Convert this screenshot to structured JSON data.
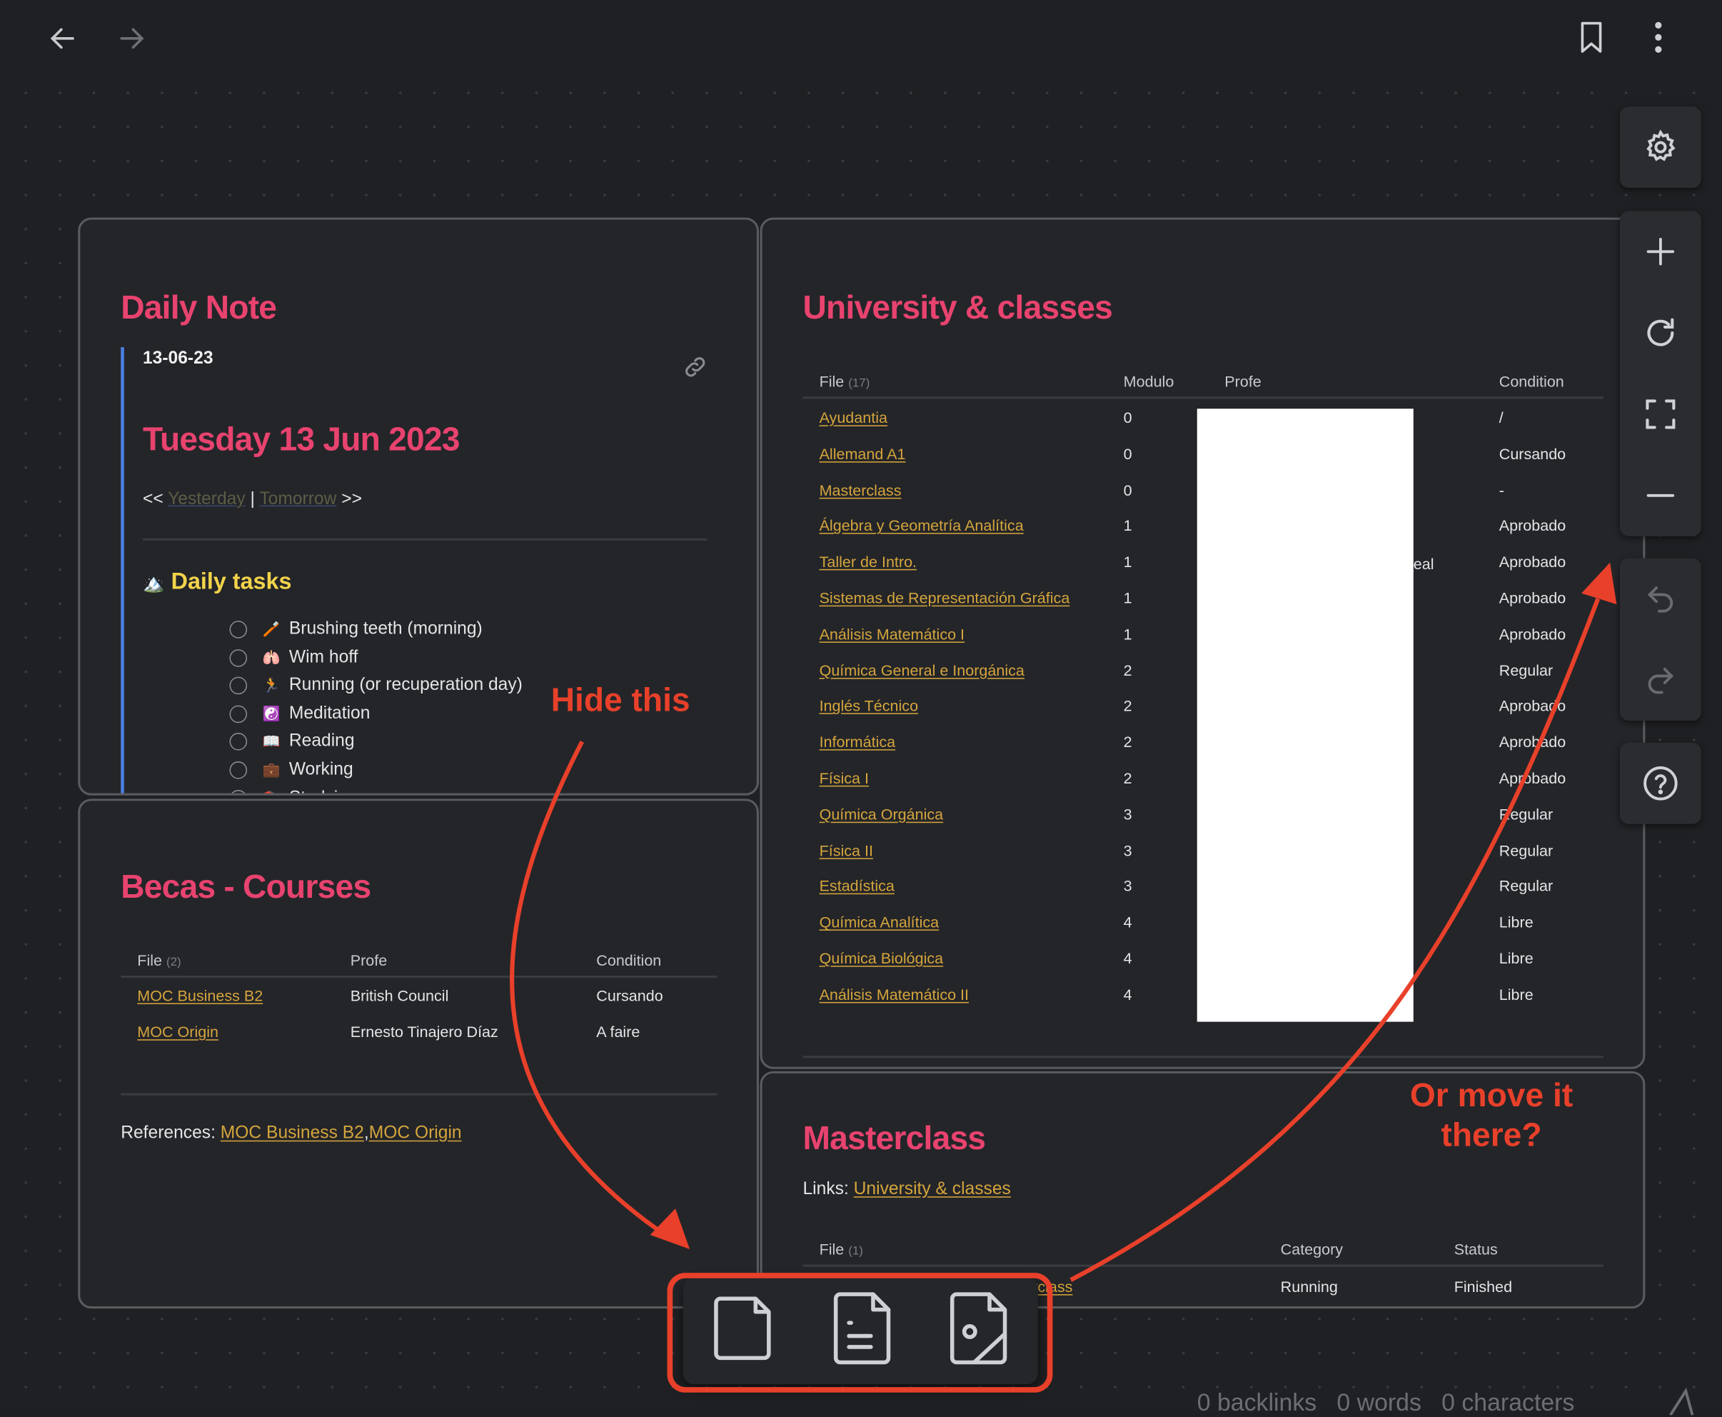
{
  "nav": {
    "back_icon": "arrow-left-icon",
    "forward_icon": "arrow-right-icon",
    "bookmark_icon": "bookmark-icon",
    "more_icon": "kebab-icon"
  },
  "daily_note": {
    "title": "Daily Note",
    "date": "13-06-23",
    "heading": "Tuesday 13 Jun 2023",
    "nav_prefix": "<<",
    "yesterday": "Yesterday",
    "separator": "|",
    "tomorrow": "Tomorrow",
    "nav_suffix": ">>",
    "tasks_heading": "Daily tasks",
    "tasks_emoji": "🏔️",
    "tasks": [
      {
        "emoji": "🪥",
        "label": "Brushing teeth (morning)"
      },
      {
        "emoji": "🫁",
        "label": "Wim hoff"
      },
      {
        "emoji": "🏃",
        "label": "Running (or recuperation day)"
      },
      {
        "emoji": "☯️",
        "label": "Meditation"
      },
      {
        "emoji": "📖",
        "label": "Reading"
      },
      {
        "emoji": "💼",
        "label": "Working"
      },
      {
        "emoji": "📚",
        "label": "Studying"
      }
    ]
  },
  "becas": {
    "title": "Becas - Courses",
    "headers": {
      "file": "File",
      "count": "(2)",
      "profe": "Profe",
      "condition": "Condition"
    },
    "rows": [
      {
        "file": "MOC Business B2",
        "profe": "British Council",
        "condition": "Cursando"
      },
      {
        "file": "MOC Origin",
        "profe": "Ernesto Tinajero Díaz",
        "condition": "A faire"
      }
    ],
    "references_label": "References:",
    "ref1": "MOC Business B2",
    "ref_sep": ",",
    "ref2": "MOC Origin"
  },
  "university": {
    "title": "University & classes",
    "headers": {
      "file": "File",
      "count": "(17)",
      "modulo": "Modulo",
      "profe": "Profe",
      "condition": "Condition"
    },
    "profe_partial": "eal",
    "rows": [
      {
        "file": "Ayudantia",
        "modulo": "0",
        "condition": "/"
      },
      {
        "file": "Allemand A1",
        "modulo": "0",
        "condition": "Cursando"
      },
      {
        "file": "Masterclass",
        "modulo": "0",
        "condition": "-"
      },
      {
        "file": "Álgebra y Geometría Analítica",
        "modulo": "1",
        "condition": "Aprobado"
      },
      {
        "file": "Taller de Intro.",
        "modulo": "1",
        "condition": "Aprobado"
      },
      {
        "file": "Sistemas de Representación Gráfica",
        "modulo": "1",
        "condition": "Aprobado"
      },
      {
        "file": "Análisis Matemático I",
        "modulo": "1",
        "condition": "Aprobado"
      },
      {
        "file": "Química General e Inorgánica",
        "modulo": "2",
        "condition": "Regular"
      },
      {
        "file": "Inglés Técnico",
        "modulo": "2",
        "condition": "Aprobado"
      },
      {
        "file": "Informática",
        "modulo": "2",
        "condition": "Aprobado"
      },
      {
        "file": "Física I",
        "modulo": "2",
        "condition": "Aprobado"
      },
      {
        "file": "Química Orgánica",
        "modulo": "3",
        "condition": "Regular"
      },
      {
        "file": "Física II",
        "modulo": "3",
        "condition": "Regular"
      },
      {
        "file": "Estadística",
        "modulo": "3",
        "condition": "Regular"
      },
      {
        "file": "Química Analítica",
        "modulo": "4",
        "condition": "Libre"
      },
      {
        "file": "Química Biológica",
        "modulo": "4",
        "condition": "Libre"
      },
      {
        "file": "Análisis Matemático II",
        "modulo": "4",
        "condition": "Libre"
      }
    ]
  },
  "masterclass": {
    "title": "Masterclass",
    "links_label": "Links:",
    "link": "University & classes",
    "headers": {
      "file": "File",
      "count": "(1)",
      "category": "Category",
      "status": "Status"
    },
    "rows": [
      {
        "file": "Masterclass",
        "category": "Running",
        "status": "Finished"
      }
    ]
  },
  "canvas_controls": [
    "settings-icon",
    "plus-icon",
    "refresh-icon",
    "fullscreen-icon",
    "minus-icon",
    "undo-icon",
    "redo-icon",
    "help-icon"
  ],
  "bottom_toolbar": [
    "new-note-icon",
    "file-text-icon",
    "file-image-icon"
  ],
  "status_bar": {
    "backlinks": "0 backlinks",
    "words": "0 words",
    "characters": "0 characters"
  },
  "annotations": {
    "hide": "Hide this",
    "move_line1": "Or move it",
    "move_line2": "there?"
  },
  "colors": {
    "accent_title": "#e8436f",
    "link": "#d4a53c",
    "tasks_heading": "#f2d44b",
    "annotation": "#e8402a",
    "blockquote_bar": "#4a7fe0"
  }
}
